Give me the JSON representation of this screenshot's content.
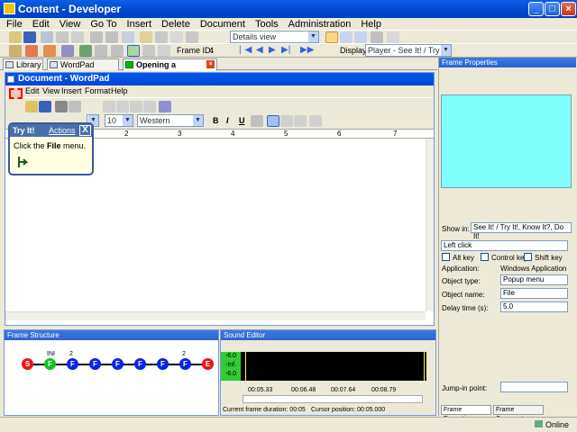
{
  "window": {
    "title": "Content - Developer"
  },
  "menu": [
    "File",
    "Edit",
    "View",
    "Go To",
    "Insert",
    "Delete",
    "Document",
    "Tools",
    "Administration",
    "Help"
  ],
  "toolbar": {
    "view_combo": "Details view",
    "frame_id_label": "Frame ID:",
    "frame_id_value": "4",
    "display_label": "Display:",
    "display_value": "Player - See It! / Try It!"
  },
  "tabs": [
    "Library",
    "WordPad Training",
    "Opening a Document"
  ],
  "wordpad": {
    "title": "Document - WordPad",
    "menu": [
      "File",
      "Edit",
      "View",
      "Insert",
      "Format",
      "Help"
    ],
    "font_size": "10",
    "script": "Western",
    "format_buttons": [
      "B",
      "I",
      "U"
    ]
  },
  "ruler_ticks": [
    "1",
    "2",
    "3",
    "4",
    "5",
    "6",
    "7"
  ],
  "callout": {
    "title": "Try It!",
    "actions": "Actions",
    "close": "X",
    "text_pre": "Click the ",
    "text_bold": "File",
    "text_post": " menu."
  },
  "frame_structure": {
    "title": "Frame Structure",
    "nodes": [
      {
        "label": "S",
        "color": "#e8161e"
      },
      {
        "label": "F",
        "color": "#12c41b",
        "note": "INI"
      },
      {
        "label": "F",
        "color": "#0a24e6",
        "note": "2"
      },
      {
        "label": "F",
        "color": "#0a24e6"
      },
      {
        "label": "F",
        "color": "#0a24e6"
      },
      {
        "label": "F",
        "color": "#0a24e6"
      },
      {
        "label": "F",
        "color": "#0a24e6"
      },
      {
        "label": "F",
        "color": "#0a24e6",
        "note": "2"
      },
      {
        "label": "E",
        "color": "#e8161e"
      }
    ]
  },
  "sound_editor": {
    "title": "Sound Editor",
    "levels": [
      "-6.0",
      "-Inf.",
      "-6.0"
    ],
    "timeline": [
      "00:05.33",
      "00:06.48",
      "00:07.64",
      "00:08.79"
    ],
    "frame_duration": "Current frame duration: 00:05",
    "cursor_position": "Cursor position: 00:05.000"
  },
  "frame_properties": {
    "title": "Frame Properties",
    "show_in_label": "Show in:",
    "show_in_value": "See It! / Try It!, Know It?, Do It!",
    "action": "Left click",
    "alt_key": "Alt key",
    "control_key": "Control key",
    "shift_key": "Shift key",
    "application_label": "Application:",
    "application_value": "Windows Application",
    "object_type_label": "Object type:",
    "object_type_value": "Popup menu",
    "object_name_label": "Object name:",
    "object_name_value": "File",
    "delay_label": "Delay time (s):",
    "delay_value": "5.0",
    "jump_in_label": "Jump-in point:",
    "tabs": [
      "Frame Properties",
      "Frame Comments"
    ]
  },
  "status": {
    "online": "Online"
  },
  "colors": {
    "title_blue": "#0a5fe6",
    "preview_cyan": "#80fffd",
    "node_blue": "#0a24e6"
  }
}
